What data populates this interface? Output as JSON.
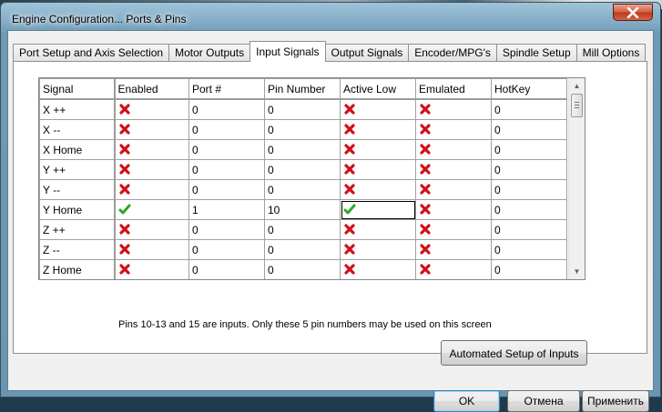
{
  "window": {
    "title": "Engine Configuration... Ports & Pins"
  },
  "tabs": [
    {
      "label": "Port Setup and Axis Selection",
      "active": false
    },
    {
      "label": "Motor Outputs",
      "active": false
    },
    {
      "label": "Input Signals",
      "active": true
    },
    {
      "label": "Output Signals",
      "active": false
    },
    {
      "label": "Encoder/MPG's",
      "active": false
    },
    {
      "label": "Spindle Setup",
      "active": false
    },
    {
      "label": "Mill Options",
      "active": false
    }
  ],
  "grid": {
    "columns": [
      "Signal",
      "Enabled",
      "Port #",
      "Pin Number",
      "Active Low",
      "Emulated",
      "HotKey"
    ],
    "rows": [
      {
        "signal": "X ++",
        "enabled": false,
        "port": "0",
        "pin": "0",
        "active_low": false,
        "emulated": false,
        "hotkey": "0"
      },
      {
        "signal": "X --",
        "enabled": false,
        "port": "0",
        "pin": "0",
        "active_low": false,
        "emulated": false,
        "hotkey": "0"
      },
      {
        "signal": "X Home",
        "enabled": false,
        "port": "0",
        "pin": "0",
        "active_low": false,
        "emulated": false,
        "hotkey": "0"
      },
      {
        "signal": "Y ++",
        "enabled": false,
        "port": "0",
        "pin": "0",
        "active_low": false,
        "emulated": false,
        "hotkey": "0"
      },
      {
        "signal": "Y --",
        "enabled": false,
        "port": "0",
        "pin": "0",
        "active_low": false,
        "emulated": false,
        "hotkey": "0"
      },
      {
        "signal": "Y Home",
        "enabled": true,
        "port": "1",
        "pin": "10",
        "active_low": true,
        "emulated": false,
        "hotkey": "0"
      },
      {
        "signal": "Z ++",
        "enabled": false,
        "port": "0",
        "pin": "0",
        "active_low": false,
        "emulated": false,
        "hotkey": "0"
      },
      {
        "signal": "Z --",
        "enabled": false,
        "port": "0",
        "pin": "0",
        "active_low": false,
        "emulated": false,
        "hotkey": "0"
      },
      {
        "signal": "Z Home",
        "enabled": false,
        "port": "0",
        "pin": "0",
        "active_low": false,
        "emulated": false,
        "hotkey": "0"
      }
    ]
  },
  "note": "Pins 10-13 and 15 are inputs. Only these 5 pin numbers may be used on this screen",
  "buttons": {
    "auto_setup": "Automated Setup of Inputs",
    "ok": "OK",
    "cancel": "Отмена",
    "apply": "Применить"
  },
  "colors": {
    "cross": "#d0101a",
    "check": "#2fa82a"
  },
  "icons": {
    "disabled": "red-x-icon",
    "enabled": "green-check-icon"
  }
}
